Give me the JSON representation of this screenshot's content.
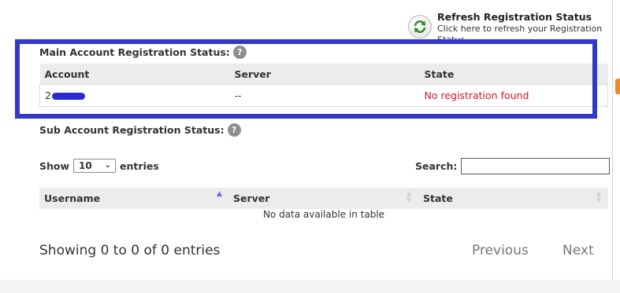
{
  "refresh": {
    "title": "Refresh Registration Status",
    "description": "Click here to refresh your Registration Status",
    "icon": "refresh-arrows-icon"
  },
  "main_section": {
    "label": "Main Account Registration Status:",
    "help": "?",
    "columns": [
      "Account",
      "Server",
      "State"
    ],
    "row": {
      "account": "2",
      "server": "--",
      "state": "No registration found"
    },
    "state_color": "#d9112a",
    "highlight_color": "#3238c7"
  },
  "sub_section": {
    "label": "Sub Account Registration Status:",
    "help": "?",
    "length": {
      "prefix": "Show",
      "selected": "10",
      "suffix": "entries"
    },
    "search_label": "Search:",
    "search_value": "",
    "columns": [
      "Username",
      "Server",
      "State"
    ],
    "empty_message": "No data available in table",
    "info": "Showing 0 to 0 of 0 entries",
    "previous": "Previous",
    "next": "Next"
  }
}
